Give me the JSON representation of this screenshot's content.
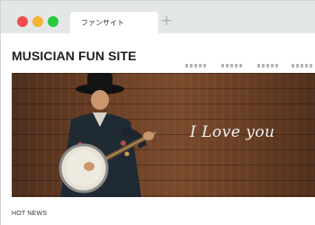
{
  "window": {
    "buttons": {
      "close_color": "#f24c4c",
      "minimize_color": "#f5b335",
      "maximize_color": "#28c940"
    }
  },
  "tab": {
    "title": "ファンサイト",
    "new_tab_icon": "plus-icon"
  },
  "site": {
    "title": "MUSICIAN FUN SITE",
    "nav_items": [
      "nav-placeholder-1",
      "nav-placeholder-2",
      "nav-placeholder-3",
      "nav-placeholder-4"
    ]
  },
  "hero": {
    "text": "I Love you",
    "image": "banjo-player-photo"
  },
  "section": {
    "heading": "HOT NEWS"
  }
}
